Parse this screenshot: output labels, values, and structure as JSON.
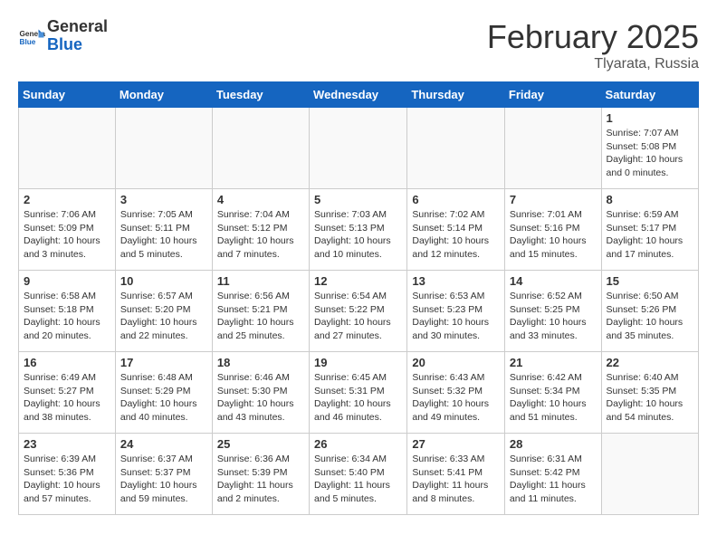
{
  "header": {
    "logo": {
      "general": "General",
      "blue": "Blue"
    },
    "title": "February 2025",
    "subtitle": "Tlyarata, Russia"
  },
  "calendar": {
    "days_of_week": [
      "Sunday",
      "Monday",
      "Tuesday",
      "Wednesday",
      "Thursday",
      "Friday",
      "Saturday"
    ],
    "weeks": [
      [
        {
          "day": null,
          "info": null
        },
        {
          "day": null,
          "info": null
        },
        {
          "day": null,
          "info": null
        },
        {
          "day": null,
          "info": null
        },
        {
          "day": null,
          "info": null
        },
        {
          "day": null,
          "info": null
        },
        {
          "day": "1",
          "info": "Sunrise: 7:07 AM\nSunset: 5:08 PM\nDaylight: 10 hours and 0 minutes."
        }
      ],
      [
        {
          "day": "2",
          "info": "Sunrise: 7:06 AM\nSunset: 5:09 PM\nDaylight: 10 hours and 3 minutes."
        },
        {
          "day": "3",
          "info": "Sunrise: 7:05 AM\nSunset: 5:11 PM\nDaylight: 10 hours and 5 minutes."
        },
        {
          "day": "4",
          "info": "Sunrise: 7:04 AM\nSunset: 5:12 PM\nDaylight: 10 hours and 7 minutes."
        },
        {
          "day": "5",
          "info": "Sunrise: 7:03 AM\nSunset: 5:13 PM\nDaylight: 10 hours and 10 minutes."
        },
        {
          "day": "6",
          "info": "Sunrise: 7:02 AM\nSunset: 5:14 PM\nDaylight: 10 hours and 12 minutes."
        },
        {
          "day": "7",
          "info": "Sunrise: 7:01 AM\nSunset: 5:16 PM\nDaylight: 10 hours and 15 minutes."
        },
        {
          "day": "8",
          "info": "Sunrise: 6:59 AM\nSunset: 5:17 PM\nDaylight: 10 hours and 17 minutes."
        }
      ],
      [
        {
          "day": "9",
          "info": "Sunrise: 6:58 AM\nSunset: 5:18 PM\nDaylight: 10 hours and 20 minutes."
        },
        {
          "day": "10",
          "info": "Sunrise: 6:57 AM\nSunset: 5:20 PM\nDaylight: 10 hours and 22 minutes."
        },
        {
          "day": "11",
          "info": "Sunrise: 6:56 AM\nSunset: 5:21 PM\nDaylight: 10 hours and 25 minutes."
        },
        {
          "day": "12",
          "info": "Sunrise: 6:54 AM\nSunset: 5:22 PM\nDaylight: 10 hours and 27 minutes."
        },
        {
          "day": "13",
          "info": "Sunrise: 6:53 AM\nSunset: 5:23 PM\nDaylight: 10 hours and 30 minutes."
        },
        {
          "day": "14",
          "info": "Sunrise: 6:52 AM\nSunset: 5:25 PM\nDaylight: 10 hours and 33 minutes."
        },
        {
          "day": "15",
          "info": "Sunrise: 6:50 AM\nSunset: 5:26 PM\nDaylight: 10 hours and 35 minutes."
        }
      ],
      [
        {
          "day": "16",
          "info": "Sunrise: 6:49 AM\nSunset: 5:27 PM\nDaylight: 10 hours and 38 minutes."
        },
        {
          "day": "17",
          "info": "Sunrise: 6:48 AM\nSunset: 5:29 PM\nDaylight: 10 hours and 40 minutes."
        },
        {
          "day": "18",
          "info": "Sunrise: 6:46 AM\nSunset: 5:30 PM\nDaylight: 10 hours and 43 minutes."
        },
        {
          "day": "19",
          "info": "Sunrise: 6:45 AM\nSunset: 5:31 PM\nDaylight: 10 hours and 46 minutes."
        },
        {
          "day": "20",
          "info": "Sunrise: 6:43 AM\nSunset: 5:32 PM\nDaylight: 10 hours and 49 minutes."
        },
        {
          "day": "21",
          "info": "Sunrise: 6:42 AM\nSunset: 5:34 PM\nDaylight: 10 hours and 51 minutes."
        },
        {
          "day": "22",
          "info": "Sunrise: 6:40 AM\nSunset: 5:35 PM\nDaylight: 10 hours and 54 minutes."
        }
      ],
      [
        {
          "day": "23",
          "info": "Sunrise: 6:39 AM\nSunset: 5:36 PM\nDaylight: 10 hours and 57 minutes."
        },
        {
          "day": "24",
          "info": "Sunrise: 6:37 AM\nSunset: 5:37 PM\nDaylight: 10 hours and 59 minutes."
        },
        {
          "day": "25",
          "info": "Sunrise: 6:36 AM\nSunset: 5:39 PM\nDaylight: 11 hours and 2 minutes."
        },
        {
          "day": "26",
          "info": "Sunrise: 6:34 AM\nSunset: 5:40 PM\nDaylight: 11 hours and 5 minutes."
        },
        {
          "day": "27",
          "info": "Sunrise: 6:33 AM\nSunset: 5:41 PM\nDaylight: 11 hours and 8 minutes."
        },
        {
          "day": "28",
          "info": "Sunrise: 6:31 AM\nSunset: 5:42 PM\nDaylight: 11 hours and 11 minutes."
        },
        {
          "day": null,
          "info": null
        }
      ]
    ]
  }
}
